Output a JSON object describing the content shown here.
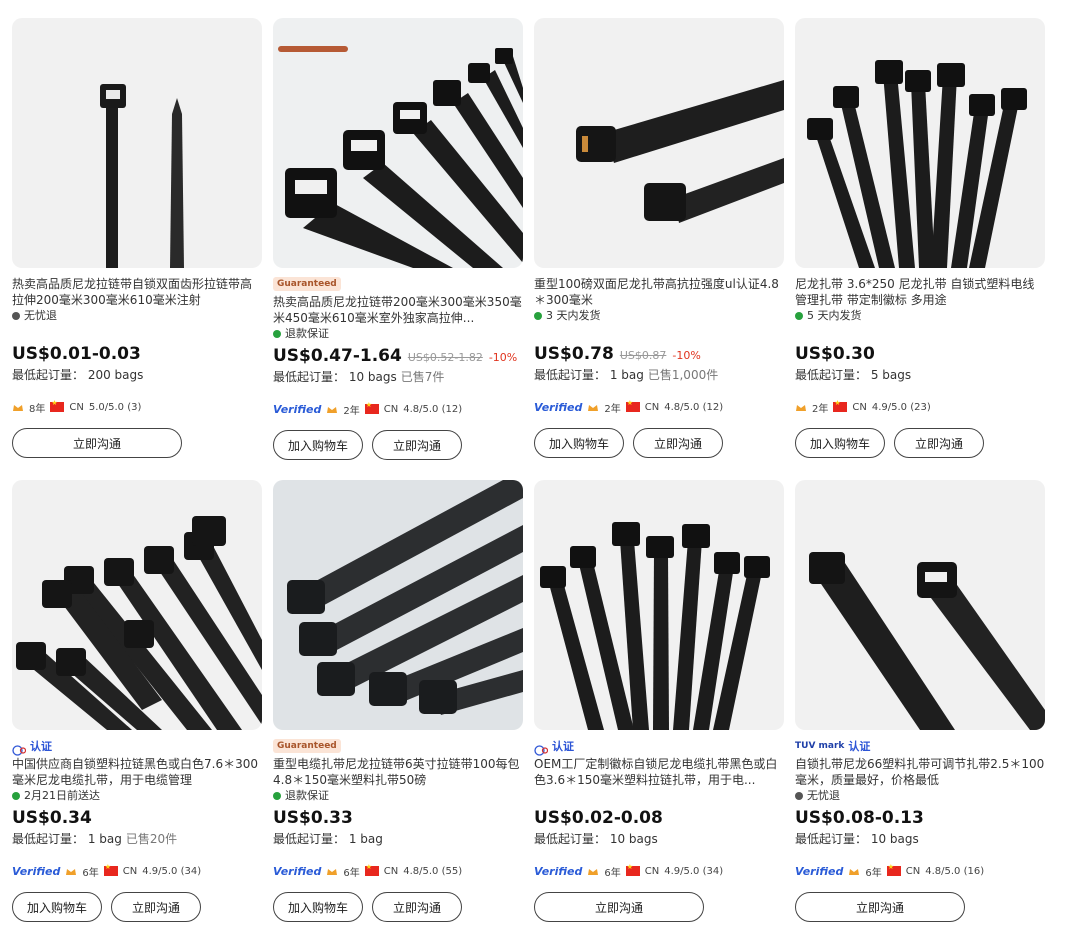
{
  "products": [
    {
      "title": "热卖高品质尼龙拉链带自锁双面齿形拉链带高拉伸200毫米300毫米610毫米注射",
      "benefit": "无忧退",
      "benefit_icon": "shield-icon",
      "price": "US$0.01-0.03",
      "moq": "最低起订量： 200 bags",
      "years": "8年",
      "country": "CN",
      "rating": "5.0/5.0 (3)",
      "buttons": [
        "立即沟通"
      ]
    },
    {
      "badge": "Guaranteed",
      "title": "热卖高品质尼龙拉链带200毫米300毫米350毫米450毫米610毫米室外独家高拉伸...",
      "benefit": "退款保证",
      "benefit_icon": "check-circle-icon",
      "price": "US$0.47-1.64",
      "old_price": "US$0.52-1.82",
      "discount": "-10%",
      "moq": "最低起订量： 10 bags",
      "sold": "已售7件",
      "verified": "Verified",
      "years": "2年",
      "country": "CN",
      "rating": "4.8/5.0 (12)",
      "buttons": [
        "加入购物车",
        "立即沟通"
      ]
    },
    {
      "title": "重型100磅双面尼龙扎带高抗拉强度ul认证4.8＊300毫米",
      "benefit": "3 天内发货",
      "benefit_icon": "check-circle-icon",
      "price": "US$0.78",
      "old_price": "US$0.87",
      "discount": "-10%",
      "moq": "最低起订量： 1 bag",
      "sold": "已售1,000件",
      "verified": "Verified",
      "years": "2年",
      "country": "CN",
      "rating": "4.8/5.0 (12)",
      "buttons": [
        "加入购物车",
        "立即沟通"
      ]
    },
    {
      "title": "尼龙扎带 3.6*250 尼龙扎带 自锁式塑料电线管理扎带 带定制徽标 多用途",
      "benefit": "5 天内发货",
      "benefit_icon": "check-circle-icon",
      "price": "US$0.30",
      "moq": "最低起订量： 5 bags",
      "years": "2年",
      "country": "CN",
      "rating": "4.9/5.0 (23)",
      "buttons": [
        "加入购物车",
        "立即沟通"
      ]
    },
    {
      "cert": "认证",
      "title": "中国供应商自锁塑料拉链黑色或白色7.6＊300毫米尼龙电缆扎带，用于电缆管理",
      "benefit": "2月21日前送达",
      "benefit_icon": "check-circle-icon",
      "price": "US$0.34",
      "moq": "最低起订量： 1 bag",
      "sold": "已售20件",
      "verified": "Verified",
      "years": "6年",
      "country": "CN",
      "rating": "4.9/5.0 (34)",
      "buttons": [
        "加入购物车",
        "立即沟通"
      ]
    },
    {
      "badge": "Guaranteed",
      "title": "重型电缆扎带尼龙拉链带6英寸拉链带100每包4.8＊150毫米塑料扎带50磅",
      "benefit": "退款保证",
      "benefit_icon": "check-circle-icon",
      "price": "US$0.33",
      "moq": "最低起订量： 1 bag",
      "verified": "Verified",
      "years": "6年",
      "country": "CN",
      "rating": "4.8/5.0 (55)",
      "buttons": [
        "加入购物车",
        "立即沟通"
      ]
    },
    {
      "cert": "认证",
      "title": "OEM工厂定制徽标自锁尼龙电缆扎带黑色或白色3.6＊150毫米塑料拉链扎带，用于电...",
      "price": "US$0.02-0.08",
      "moq": "最低起订量： 10 bags",
      "verified": "Verified",
      "years": "6年",
      "country": "CN",
      "rating": "4.9/5.0 (34)",
      "buttons": [
        "立即沟通"
      ]
    },
    {
      "tuv": "TUV mark",
      "cert": "认证",
      "title": "自锁扎带尼龙66塑料扎带可调节扎带2.5＊100毫米，质量最好，价格最低",
      "benefit": "无忧退",
      "benefit_icon": "shield-icon",
      "price": "US$0.08-0.13",
      "moq": "最低起订量： 10 bags",
      "verified": "Verified",
      "years": "6年",
      "country": "CN",
      "rating": "4.8/5.0 (16)",
      "buttons": [
        "立即沟通"
      ]
    }
  ]
}
